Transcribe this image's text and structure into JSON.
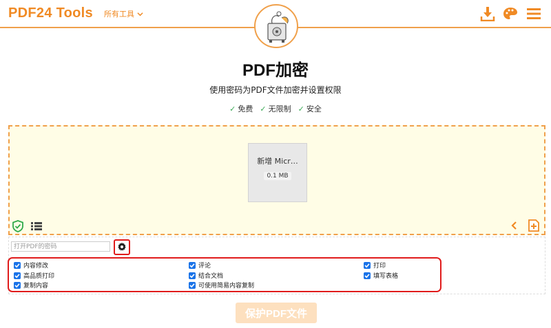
{
  "header": {
    "logo": "PDF24 Tools",
    "tools_menu": "所有工具",
    "colors": {
      "brand": "#f08a24"
    }
  },
  "page": {
    "title": "PDF加密",
    "subtitle": "使用密码为PDF文件加密并设置权限",
    "features": [
      "免费",
      "无限制",
      "安全"
    ]
  },
  "file": {
    "name": "新增 Micr…",
    "size": "0.1 MB"
  },
  "options": {
    "password_placeholder": "打开PDF的密码",
    "permissions": [
      {
        "label": "内容修改",
        "checked": true
      },
      {
        "label": "评论",
        "checked": true
      },
      {
        "label": "打印",
        "checked": true
      },
      {
        "label": "高品质打印",
        "checked": true
      },
      {
        "label": "结合文档",
        "checked": true
      },
      {
        "label": "填写表格",
        "checked": true
      },
      {
        "label": "复制内容",
        "checked": true
      },
      {
        "label": "可使用简易内容复制",
        "checked": true
      }
    ]
  },
  "submit_label": "保护PDF文件"
}
